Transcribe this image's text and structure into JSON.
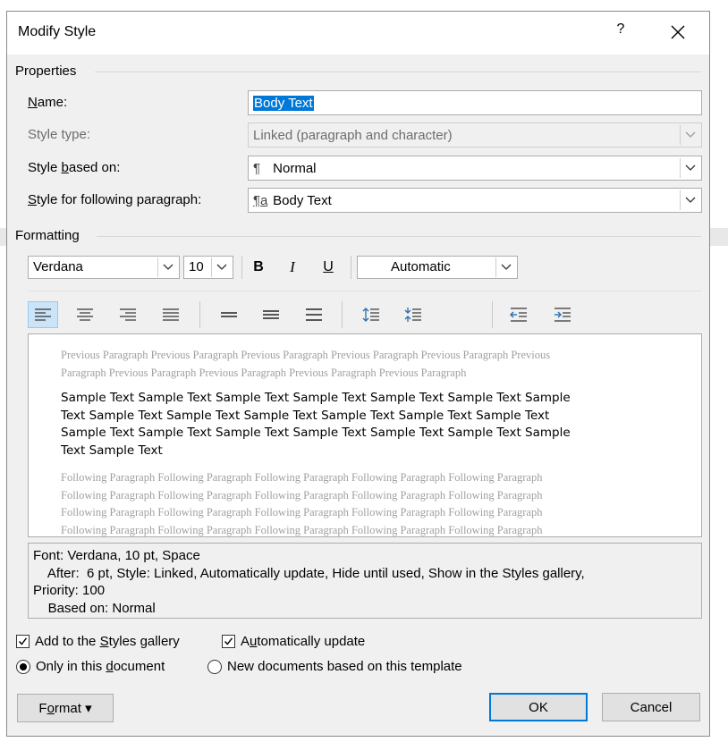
{
  "dialog": {
    "title": "Modify Style",
    "help_glyph": "?"
  },
  "properties": {
    "group_title": "Properties",
    "name_label_pre": "",
    "name_label_accel": "N",
    "name_label_post": "ame:",
    "name_value": "Body Text",
    "style_type_label": "Style type:",
    "style_type_value": "Linked (paragraph and character)",
    "based_on_label_pre": "Style ",
    "based_on_label_accel": "b",
    "based_on_label_post": "ased on:",
    "based_on_value": "Normal",
    "based_on_glyph": "¶",
    "following_label_pre": "",
    "following_label_accel": "S",
    "following_label_post": "tyle for following paragraph:",
    "following_value": "Body Text",
    "following_glyph": "¶a"
  },
  "formatting": {
    "group_title": "Formatting",
    "font": "Verdana",
    "size": "10",
    "bold": "B",
    "italic": "I",
    "underline": "U",
    "color": "Automatic"
  },
  "preview": {
    "previous_lines": [
      "Previous Paragraph Previous Paragraph Previous Paragraph Previous Paragraph Previous Paragraph Previous",
      "Paragraph Previous Paragraph Previous Paragraph Previous Paragraph Previous Paragraph"
    ],
    "sample_lines": [
      "Sample Text Sample Text Sample Text Sample Text Sample Text Sample Text Sample",
      "Text Sample Text Sample Text Sample Text Sample Text Sample Text Sample Text",
      "Sample Text Sample Text Sample Text Sample Text Sample Text Sample Text Sample",
      "Text Sample Text"
    ],
    "following_lines": [
      "Following Paragraph Following Paragraph Following Paragraph Following Paragraph Following Paragraph",
      "Following Paragraph Following Paragraph Following Paragraph Following Paragraph Following Paragraph",
      "Following Paragraph Following Paragraph Following Paragraph Following Paragraph Following Paragraph",
      "Following Paragraph Following Paragraph Following Paragraph Following Paragraph Following Paragraph"
    ]
  },
  "description": {
    "lines": [
      "Font: Verdana, 10 pt, Space",
      "    After:  6 pt, Style: Linked, Automatically update, Hide until used, Show in the Styles gallery,",
      "Priority: 100",
      "    Based on: Normal"
    ]
  },
  "options": {
    "add_gallery_pre": "Add to the ",
    "add_gallery_accel": "S",
    "add_gallery_post": "tyles gallery",
    "add_gallery_checked": true,
    "auto_update_pre": "A",
    "auto_update_accel": "u",
    "auto_update_post": "tomatically update",
    "auto_update_checked": true,
    "only_doc_pre": "Only in this ",
    "only_doc_accel": "d",
    "only_doc_post": "ocument",
    "only_doc_selected": true,
    "new_docs_label": "New documents based on this template",
    "new_docs_selected": false
  },
  "buttons": {
    "format_pre": "F",
    "format_accel": "o",
    "format_post": "rmat",
    "format_arrow": "▾",
    "ok": "OK",
    "cancel": "Cancel"
  },
  "colors": {
    "dialog_bg": "#f0f0f0",
    "selection": "#0078d7",
    "default_button_border": "#0078d7",
    "active_toolbar_bg": "#cce4f7"
  }
}
